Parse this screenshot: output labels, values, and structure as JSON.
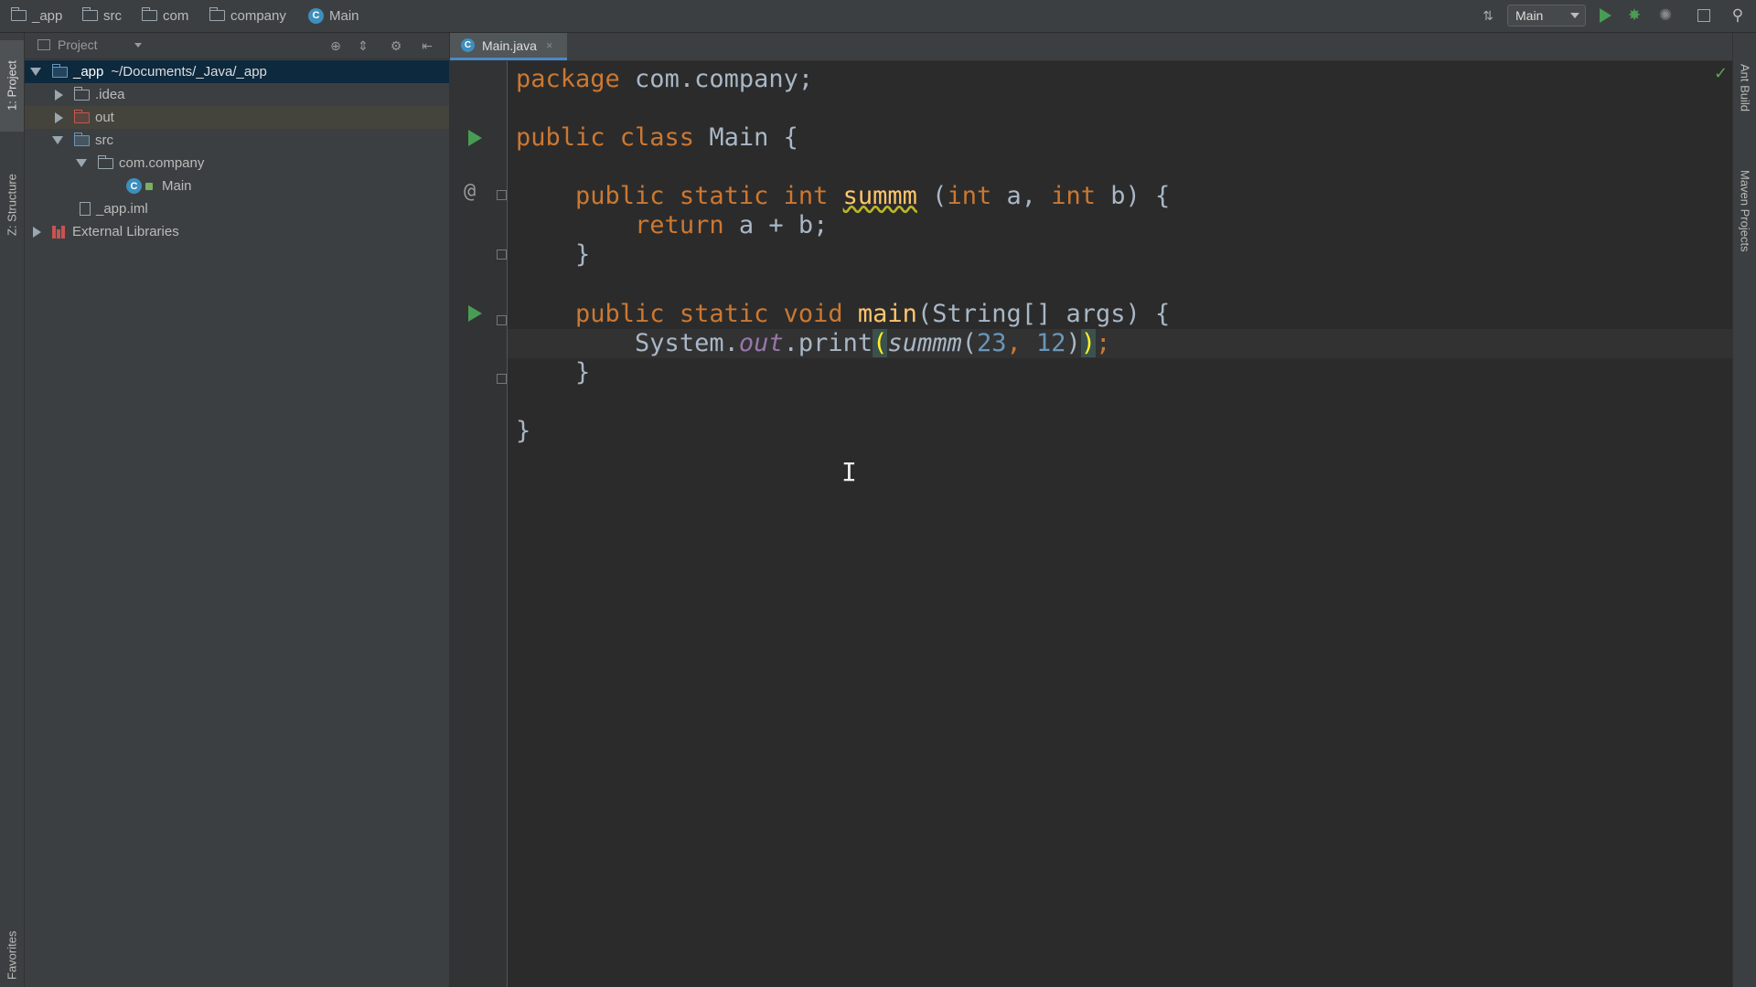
{
  "navbar": {
    "crumbs": [
      "_app",
      "src",
      "com",
      "company",
      "Main"
    ],
    "run_config": "Main"
  },
  "left_stripe": {
    "project_tab": "1: Project",
    "structure_tab": "Z: Structure",
    "favorites_tab": "Favorites"
  },
  "right_stripe": {
    "ant_tab": "Ant Build",
    "maven_tab": "Maven Projects"
  },
  "project": {
    "title": "Project",
    "tree": [
      {
        "label": "_app",
        "path": "~/Documents/_Java/_app"
      },
      {
        "label": ".idea"
      },
      {
        "label": "out"
      },
      {
        "label": "src"
      },
      {
        "label": "com.company"
      },
      {
        "label": "Main"
      },
      {
        "label": "_app.iml"
      },
      {
        "label": "External Libraries"
      }
    ]
  },
  "editor": {
    "tab": "Main.java",
    "code": {
      "l1_kw": "package",
      "l1_rest": " com.company;",
      "l2_kw": "public class",
      "l2_rest": " Main {",
      "l3_indent": "    ",
      "l3_kw": "public static int",
      "l3_sp": " ",
      "l3_fn": "summm",
      "l3_paren": " (",
      "l3_kw2": "int",
      "l3_a": " a, ",
      "l3_kw3": "int",
      "l3_b": " b) {",
      "l4_indent": "        ",
      "l4_kw": "return",
      "l4_rest": " a + b;",
      "l5": "    }",
      "l6_indent": "    ",
      "l6_kw": "public static void",
      "l6_sp": " ",
      "l6_fn": "main",
      "l6_rest": "(String[] args) {",
      "l7_indent": "        ",
      "l7_sys": "System.",
      "l7_field": "out",
      "l7_print": ".print",
      "l7_open": "(",
      "l7_call": "summm",
      "l7_args_open": "(",
      "l7_n1": "23",
      "l7_comma": ", ",
      "l7_n2": "12",
      "l7_close1": ")",
      "l7_close2": ")",
      "l7_semi": ";",
      "l8": "    }",
      "l9": "}"
    }
  },
  "colors": {
    "keyword": "#cc7832",
    "function": "#ffc66d",
    "number": "#6897bb",
    "field": "#9876aa",
    "text": "#a9b7c6",
    "background": "#2b2b2b",
    "selection": "#0d293e"
  },
  "icons": [
    "folder-icon",
    "class-icon",
    "run-icon",
    "debug-icon",
    "search-icon",
    "check-icon",
    "text-cursor-icon"
  ]
}
